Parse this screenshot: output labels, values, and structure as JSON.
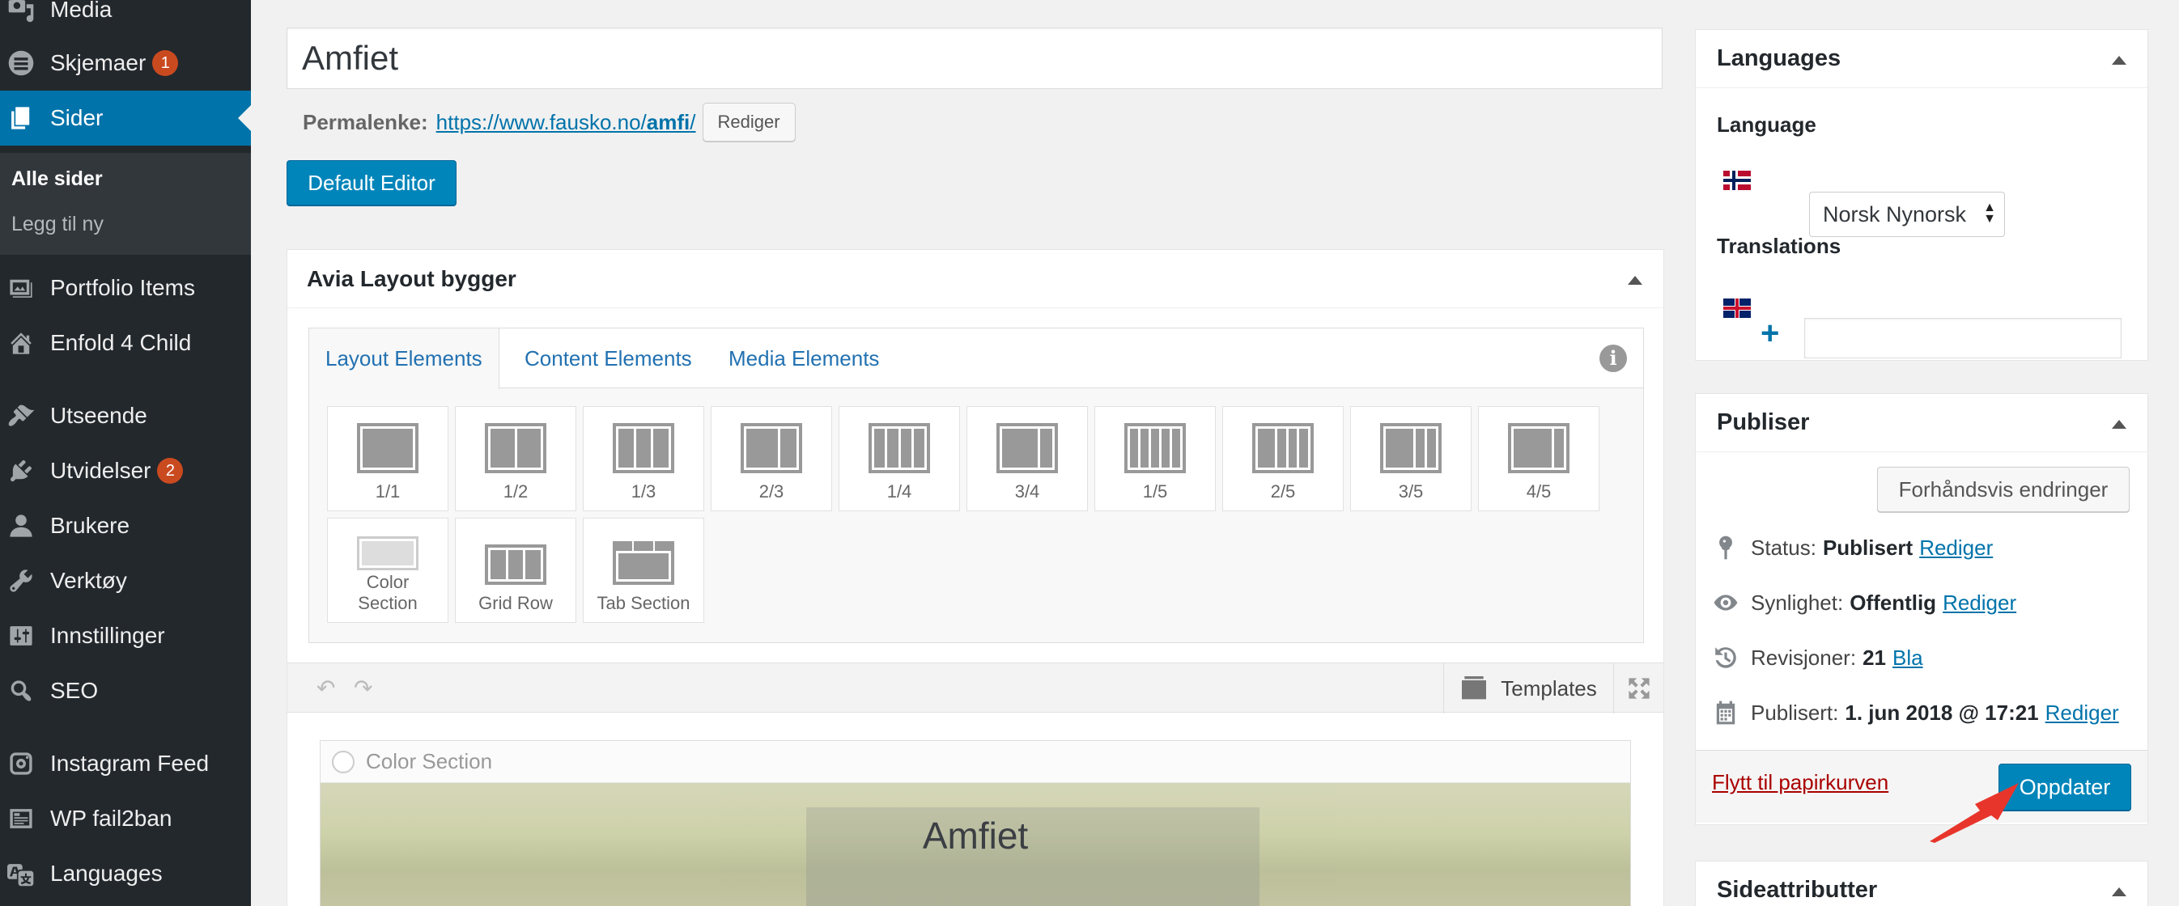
{
  "sidebar": {
    "items": [
      {
        "label": "Media",
        "icon": "media-icon",
        "badge": ""
      },
      {
        "label": "Skjemaer",
        "icon": "forms-icon",
        "badge": "1"
      },
      {
        "label": "Sider",
        "icon": "pages-icon",
        "badge": ""
      },
      {
        "label": "Portfolio Items",
        "icon": "portfolio-icon",
        "badge": ""
      },
      {
        "label": "Enfold 4 Child",
        "icon": "home-icon",
        "badge": ""
      },
      {
        "label": "Utseende",
        "icon": "brush-icon",
        "badge": ""
      },
      {
        "label": "Utvidelser",
        "icon": "plugin-icon",
        "badge": "2"
      },
      {
        "label": "Brukere",
        "icon": "user-icon",
        "badge": ""
      },
      {
        "label": "Verktøy",
        "icon": "wrench-icon",
        "badge": ""
      },
      {
        "label": "Innstillinger",
        "icon": "settings-icon",
        "badge": ""
      },
      {
        "label": "SEO",
        "icon": "search-icon",
        "badge": ""
      },
      {
        "label": "Instagram Feed",
        "icon": "instagram-icon",
        "badge": ""
      },
      {
        "label": "WP fail2ban",
        "icon": "fail2ban-icon",
        "badge": ""
      },
      {
        "label": "Languages",
        "icon": "translate-icon",
        "badge": ""
      }
    ],
    "submenu": {
      "all_pages": "Alle sider",
      "add_new": "Legg til ny"
    }
  },
  "editor": {
    "title_value": "Amfiet",
    "permalink_label": "Permalenke:",
    "permalink_base": "https://www.fausko.no/",
    "permalink_slug": "amfi",
    "permalink_end": "/",
    "edit_button": "Rediger",
    "default_editor_button": "Default Editor"
  },
  "builder": {
    "title": "Avia Layout bygger",
    "tabs": [
      "Layout Elements",
      "Content Elements",
      "Media Elements"
    ],
    "elements": [
      {
        "label": "1/1",
        "icon": "column-1-1-icon"
      },
      {
        "label": "1/2",
        "icon": "column-1-2-icon"
      },
      {
        "label": "1/3",
        "icon": "column-1-3-icon"
      },
      {
        "label": "2/3",
        "icon": "column-2-3-icon"
      },
      {
        "label": "1/4",
        "icon": "column-1-4-icon"
      },
      {
        "label": "3/4",
        "icon": "column-3-4-icon"
      },
      {
        "label": "1/5",
        "icon": "column-1-5-icon"
      },
      {
        "label": "2/5",
        "icon": "column-2-5-icon"
      },
      {
        "label": "3/5",
        "icon": "column-3-5-icon"
      },
      {
        "label": "4/5",
        "icon": "column-4-5-icon"
      },
      {
        "label": "Color Section",
        "icon": "color-section-icon"
      },
      {
        "label": "Grid Row",
        "icon": "grid-row-icon"
      },
      {
        "label": "Tab Section",
        "icon": "tab-section-icon"
      }
    ],
    "templates_button": "Templates",
    "canvas_section_label": "Color Section",
    "canvas_section_title": "Amfiet"
  },
  "languages_box": {
    "title": "Languages",
    "language_label": "Language",
    "language_value": "Norsk Nynorsk",
    "translations_label": "Translations",
    "translation_input_value": ""
  },
  "publish_box": {
    "title": "Publiser",
    "preview_button": "Forhåndsvis endringer",
    "status_label": "Status:",
    "status_value": "Publisert",
    "status_link": "Rediger",
    "visibility_label": "Synlighet:",
    "visibility_value": "Offentlig",
    "visibility_link": "Rediger",
    "revisions_label": "Revisjoner:",
    "revisions_value": "21",
    "revisions_link": "Bla",
    "published_label": "Publisert:",
    "published_value": "1. jun 2018 @ 17:21",
    "published_link": "Rediger",
    "trash_link": "Flytt til papirkurven",
    "update_button": "Oppdater"
  },
  "page_attributes_box": {
    "title": "Sideattributter"
  },
  "colors": {
    "accent": "#0073aa",
    "button": "#0085ba",
    "sidebar": "#23282d",
    "badge": "#ca4a1f",
    "annotation_arrow": "#e8352b"
  }
}
